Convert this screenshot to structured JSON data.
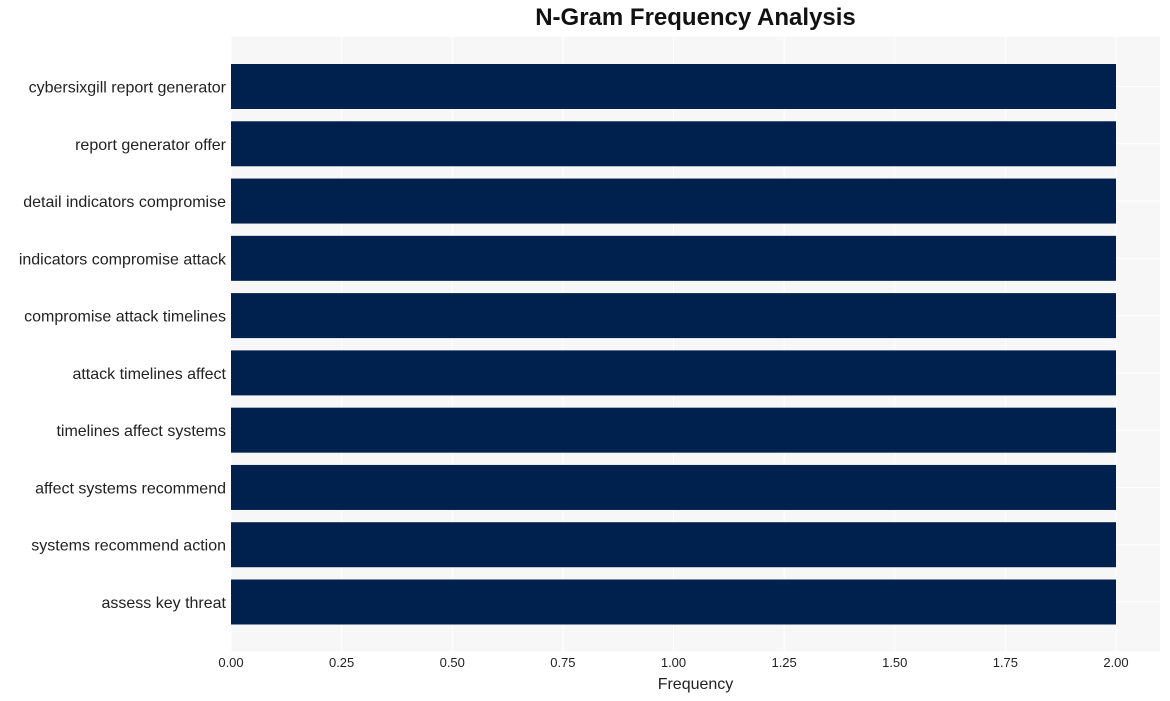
{
  "chart_data": {
    "type": "bar",
    "orientation": "horizontal",
    "title": "N-Gram Frequency Analysis",
    "xlabel": "Frequency",
    "ylabel": "",
    "categories": [
      "cybersixgill report generator",
      "report generator offer",
      "detail indicators compromise",
      "indicators compromise attack",
      "compromise attack timelines",
      "attack timelines affect",
      "timelines affect systems",
      "affect systems recommend",
      "systems recommend action",
      "assess key threat"
    ],
    "values": [
      2,
      2,
      2,
      2,
      2,
      2,
      2,
      2,
      2,
      2
    ],
    "xlim": [
      0,
      2.1
    ],
    "xticks": [
      0,
      0.25,
      0.5,
      0.75,
      1.0,
      1.25,
      1.5,
      1.75,
      2.0
    ],
    "xtick_labels": [
      "0.00",
      "0.25",
      "0.50",
      "0.75",
      "1.00",
      "1.25",
      "1.50",
      "1.75",
      "2.00"
    ],
    "grid": true,
    "legend": "none",
    "colors": {
      "bar": "#00214d",
      "plot_background": "#f7f7f7",
      "grid": "#ffffff"
    }
  }
}
